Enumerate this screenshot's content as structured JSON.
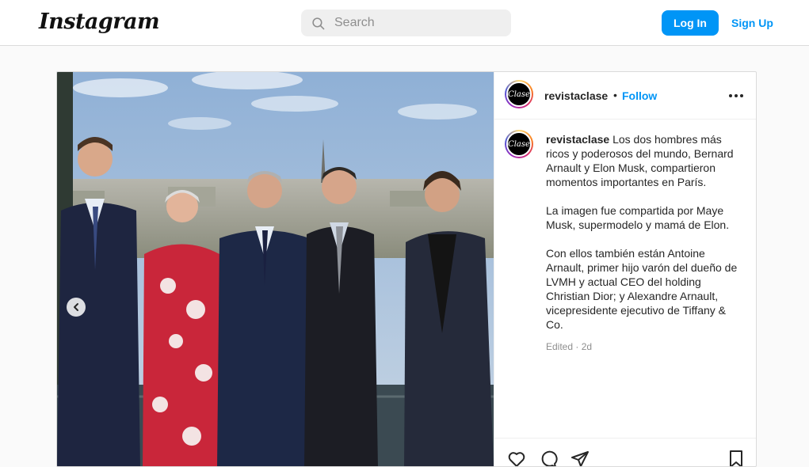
{
  "app": {
    "logo_text": "Instagram"
  },
  "search": {
    "placeholder": "Search"
  },
  "auth": {
    "login_label": "Log In",
    "signup_label": "Sign Up"
  },
  "post": {
    "username": "revistaclase",
    "avatar_text": "Clase",
    "follow_label": "Follow",
    "separator": "•",
    "caption": {
      "username": "revistaclase",
      "paragraph1": "Los dos hombres más ricos y poderosos del mundo, Bernard Arnault y Elon Musk, compartieron momentos importantes en París.",
      "paragraph2": "La imagen fue compartida por Maye Musk, supermodelo y mamá de Elon.",
      "paragraph3": "Con ellos también están Antoine Arnault, primer hijo varón del dueño de LVMH y actual CEO del holding Christian Dior; y Alexandre Arnault, vicepresidente ejecutivo de Tiffany & Co."
    },
    "edited_label": "Edited · 2d",
    "icons": {
      "search": "search-icon",
      "more": "more-options-icon",
      "carousel_prev": "chevron-left-icon",
      "like": "heart-icon",
      "comment": "comment-icon",
      "share": "share-icon",
      "save": "bookmark-icon"
    }
  },
  "colors": {
    "accent": "#0095f6",
    "text": "#262626",
    "muted": "#8e8e8e",
    "border": "#dbdbdb"
  }
}
